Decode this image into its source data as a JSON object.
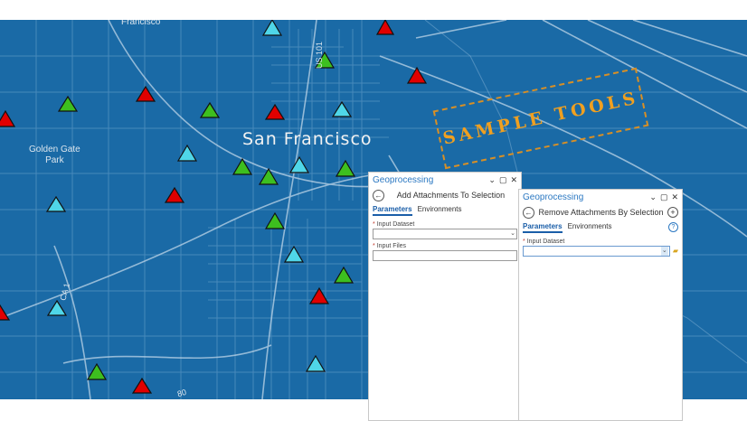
{
  "map": {
    "city_label": "San Francisco",
    "park_label_line1": "Golden Gate",
    "park_label_line2": "Park",
    "place_top": "Francisco",
    "road_us101": "US 101",
    "road_ca1": "CA 1",
    "road_i80": "80",
    "stamp_text": "SAMPLE TOOLS",
    "colors": {
      "map_bg": "#1a6aa6",
      "red": "#e00000",
      "green": "#3dbf1f",
      "cyan": "#4fd6e8"
    }
  },
  "panel1": {
    "title": "Geoprocessing",
    "tool_name": "Add Attachments To Selection",
    "tabs": [
      "Parameters",
      "Environments"
    ],
    "params": [
      {
        "label": "Input Dataset",
        "value": ""
      },
      {
        "label": "Input Files",
        "value": ""
      }
    ],
    "window_buttons": [
      "⌄",
      "▢",
      "✕"
    ]
  },
  "panel2": {
    "title": "Geoprocessing",
    "tool_name": "Remove Attachments By Selection",
    "tabs": [
      "Parameters",
      "Environments"
    ],
    "params": [
      {
        "label": "Input Dataset",
        "value": ""
      }
    ],
    "window_buttons": [
      "⌄",
      "▢",
      "✕"
    ],
    "help_icon": "help-icon",
    "folder_icon": "folder-icon"
  }
}
